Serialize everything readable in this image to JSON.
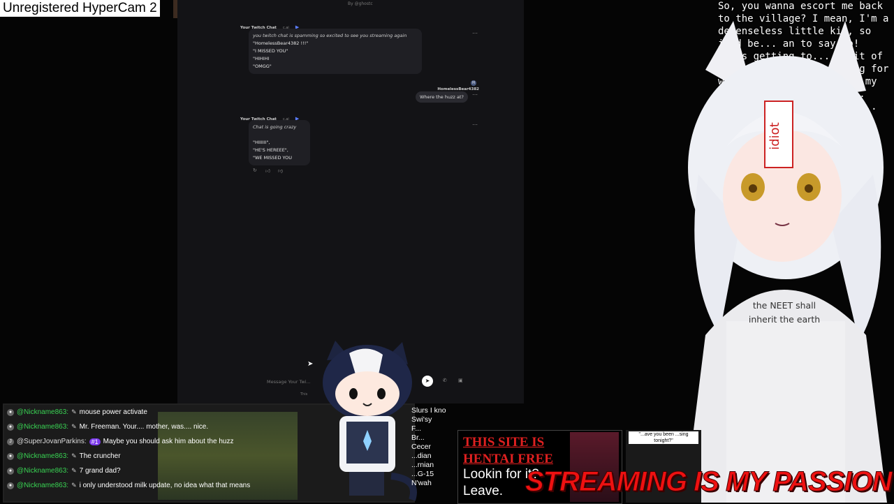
{
  "overlay": {
    "watermark": "Unregistered HyperCam 2",
    "narrative": "So, you wanna escort me back to the village? I mean, I'm a defenseless little kid, so it'd be... an to say no! ...is getting to... a bit of a ...t. Do you hav... ing for women or ...ing? ...into my ...you wish. ...I-done... ...medium- ...y of ...st...",
    "shirt_text": "the NEET shall inherit the earth",
    "headband_text": "idiot",
    "banner": "STREAMING IS MY PASSION"
  },
  "chat_app": {
    "byline": "By @ghostc",
    "messages": [
      {
        "sender": "Your Twitch Chat",
        "tag": "c.ai",
        "lines": [
          "you twitch chat is spamming so excited to see you streaming again",
          "\"HomelessBear4382 !!!\"",
          "\"I MISSED YOU\"",
          "\"HIHIHI",
          "\"OMGG\""
        ]
      },
      {
        "sender": "HomelessBear4382",
        "avatar": "H",
        "text": "Where the huzz at?"
      },
      {
        "sender": "Your Twitch Chat",
        "tag": "c.ai",
        "lines": [
          "Chat is going crazy",
          "\"HIIIIII\",",
          "\"HE'S HEREEE\",",
          "\"WE MISSED YOU"
        ]
      }
    ],
    "input_placeholder": "Message Your Twi...",
    "footer_note": "This"
  },
  "stream_chat": [
    {
      "user": "@Nickname863:",
      "msg": "mouse power activate",
      "color": "#39d353"
    },
    {
      "user": "@Nickname863:",
      "msg": "Mr. Freeman. Your.... mother, was.... nice.",
      "color": "#39d353"
    },
    {
      "user": "@SuperJovanParkins:",
      "badge": "#1",
      "msg": "Maybe you should ask him about the huzz",
      "color": "#dddddd"
    },
    {
      "user": "@Nickname863:",
      "msg": "The cruncher",
      "color": "#39d353"
    },
    {
      "user": "@Nickname863:",
      "msg": "7 grand dad?",
      "color": "#39d353"
    },
    {
      "user": "@Nickname863:",
      "msg": "i only understood milk update, no idea what that means",
      "color": "#39d353"
    }
  ],
  "side_list": [
    "Slurs I kno",
    "Swi'sy",
    "F...",
    "Br...",
    "Cecer",
    "...dian",
    "...rnian",
    "...G-15",
    "N'wah"
  ],
  "ad": {
    "line1": "THIS SITE IS",
    "line2": "HENTAI FREE",
    "line3": "Lookin for it?",
    "line4": "Leave."
  },
  "ad2": {
    "text": "\"...ave you been ...sing tonight?\""
  }
}
